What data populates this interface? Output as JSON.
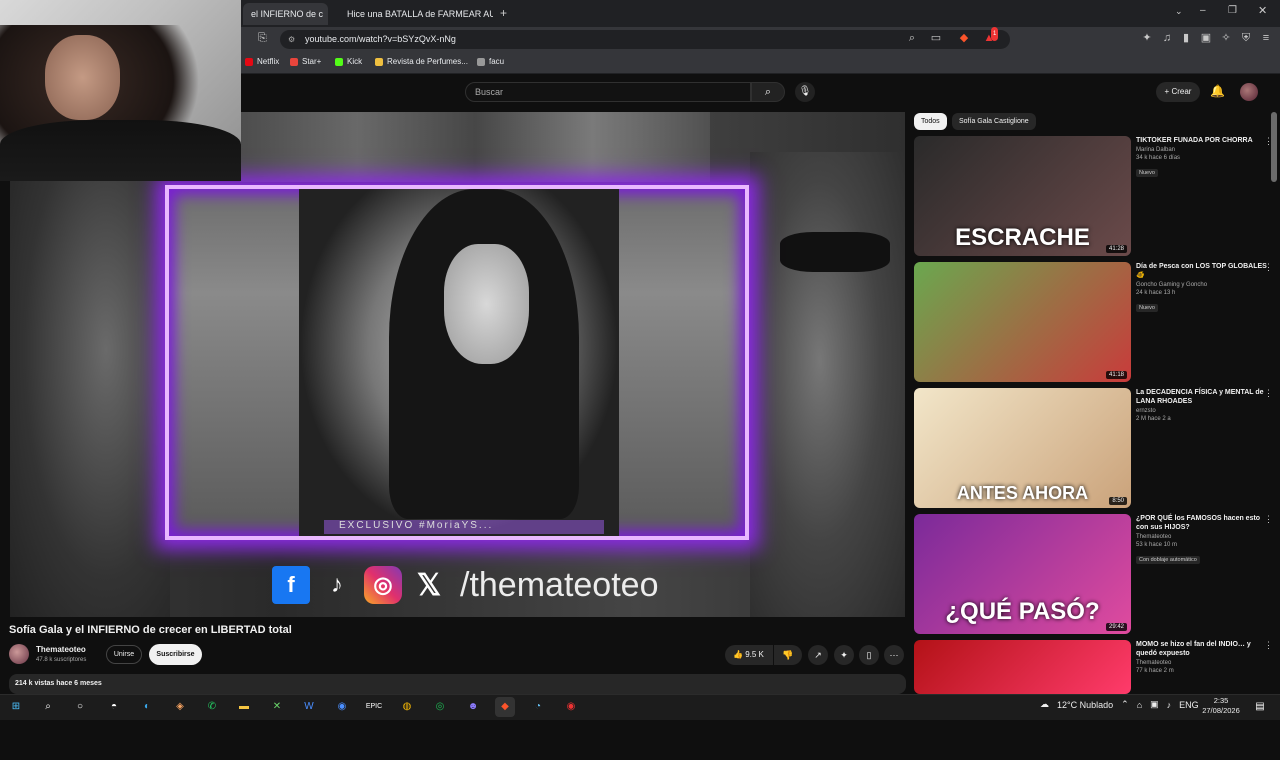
{
  "browser": {
    "tabs": [
      {
        "label": "el INFIERNO de c",
        "active": true
      },
      {
        "label": "Hice una BATALLA de FARMEAR AUR",
        "active": false
      }
    ],
    "new_tab": "+",
    "url": "youtube.com/watch?v=bSYzQvX-nNg",
    "bookmarks": [
      "Netflix",
      "Star+",
      "Kick",
      "Revista de Perfumes...",
      "facu"
    ],
    "badge_count": "1"
  },
  "youtube": {
    "search_placeholder": "Buscar",
    "create_label": "Crear",
    "video": {
      "caption_strip": "EXCLUSIVO  #MoriaYS...",
      "social_handle": "/thematеoteo",
      "social_icons": [
        "facebook-icon",
        "tiktok-icon",
        "instagram-icon",
        "x-icon"
      ]
    },
    "title": "Sofía Gala y el INFIERNO de crecer en LIBERTAD total",
    "channel": {
      "name": "Themateoteo",
      "subscribers": "47.8 k suscriptores",
      "join_label": "Unirse",
      "subscribe_label": "Suscribirse"
    },
    "likes": "9.5 K",
    "description_meta": "214 k vistas  hace 6 meses",
    "chips": [
      "Todos",
      "Sofía Gala Castiglione"
    ],
    "recommendations": [
      {
        "title": "TIKTOKER FUNADA POR CHORRA",
        "channel": "Marina Dalban",
        "meta": "34 k  hace 6 días",
        "badge": "Nuevo",
        "duration": "41:28",
        "thumb_text": "ESCRACHE",
        "thumb_colors": [
          "#2a2a2a",
          "#6b4a4a"
        ]
      },
      {
        "title": "Día de Pesca con LOS TOP GLOBALES 🐠",
        "channel": "Goncho Gaming y Goncho",
        "meta": "24 k  hace 13 h",
        "badge": "Nuevo",
        "duration": "41:18",
        "thumb_text": "",
        "thumb_colors": [
          "#6aa84f",
          "#c93b3b"
        ]
      },
      {
        "title": "La DECADENCIA FÍSICA y MENTAL de LANA RHOADES",
        "channel": "ernzsto",
        "meta": "2 M  hace 2 a",
        "badge": "",
        "duration": "8:50",
        "thumb_text": "ANTES  AHORA",
        "thumb_colors": [
          "#f2e6c9",
          "#caa27a"
        ]
      },
      {
        "title": "¿POR QUÉ los FAMOSOS hacen esto con sus HIJOS?",
        "channel": "Themateoteo",
        "meta": "53 k  hace 10 m",
        "badge": "Con doblaje automático",
        "duration": "29:42",
        "thumb_text": "¿QUÉ PASÓ?",
        "thumb_colors": [
          "#7b2a9a",
          "#e04b9e"
        ]
      },
      {
        "title": "MOMO se hizo el fan del INDIO… y quedó expuesto",
        "channel": "Themateoteo",
        "meta": "77 k  hace 2 m",
        "badge": "",
        "duration": "",
        "thumb_text": "",
        "thumb_colors": [
          "#b31217",
          "#ff3b6b"
        ]
      }
    ]
  },
  "taskbar": {
    "weather": "12°C  Nublado",
    "language": "ENG",
    "time": "2:35",
    "date": "27/08/2026"
  }
}
